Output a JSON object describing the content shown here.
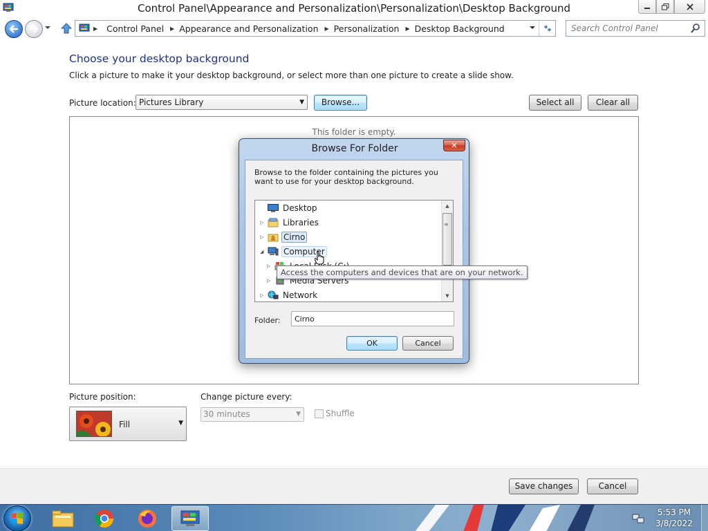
{
  "window": {
    "title": "Control Panel\\Appearance and Personalization\\Personalization\\Desktop Background"
  },
  "address": {
    "breadcrumbs": [
      "Control Panel",
      "Appearance and Personalization",
      "Personalization",
      "Desktop Background"
    ],
    "search_placeholder": "Search Control Panel"
  },
  "main": {
    "heading": "Choose your desktop background",
    "subtext": "Click a picture to make it your desktop background, or select more than one picture to create a slide show.",
    "location_label": "Picture location:",
    "location_value": "Pictures Library",
    "browse_label": "Browse...",
    "select_all_label": "Select all",
    "clear_all_label": "Clear all",
    "empty_text": "This folder is empty.",
    "position_label": "Picture position:",
    "position_value": "Fill",
    "interval_label": "Change picture every:",
    "interval_value": "30 minutes",
    "shuffle_label": "Shuffle",
    "shuffle_checked": false
  },
  "footer": {
    "save_label": "Save changes",
    "cancel_label": "Cancel"
  },
  "dialog": {
    "title": "Browse For Folder",
    "close_glyph": "✕",
    "instructions": "Browse to the folder containing the pictures you want to use for your desktop background.",
    "tree": [
      {
        "label": "Desktop",
        "icon": "desktop-icon",
        "expander": ""
      },
      {
        "label": "Libraries",
        "icon": "libraries-icon",
        "expander": "▷"
      },
      {
        "label": "Cirno",
        "icon": "user-folder-icon",
        "expander": "▷",
        "selected": true
      },
      {
        "label": "Computer",
        "icon": "computer-icon",
        "expander": "◢",
        "hovered": true
      },
      {
        "label": "Local Disk (C:)",
        "icon": "drive-icon",
        "expander": "▷"
      },
      {
        "label": "Media Servers",
        "icon": "media-server-icon",
        "expander": "▷"
      },
      {
        "label": "Network",
        "icon": "network-icon",
        "expander": "▷"
      }
    ],
    "tooltip": "Access the computers and devices that are on your network.",
    "folder_label": "Folder:",
    "folder_value": "Cirno",
    "ok_label": "OK",
    "cancel_label": "Cancel"
  },
  "taskbar": {
    "apps": [
      "windows-explorer",
      "chrome",
      "firefox",
      "control-panel"
    ],
    "time": "5:53 PM",
    "date": "3/8/2022"
  },
  "colors": {
    "heading": "#1e3287",
    "dialog_frame": "#aac5e6",
    "accent_button": "#3c7fb1"
  }
}
